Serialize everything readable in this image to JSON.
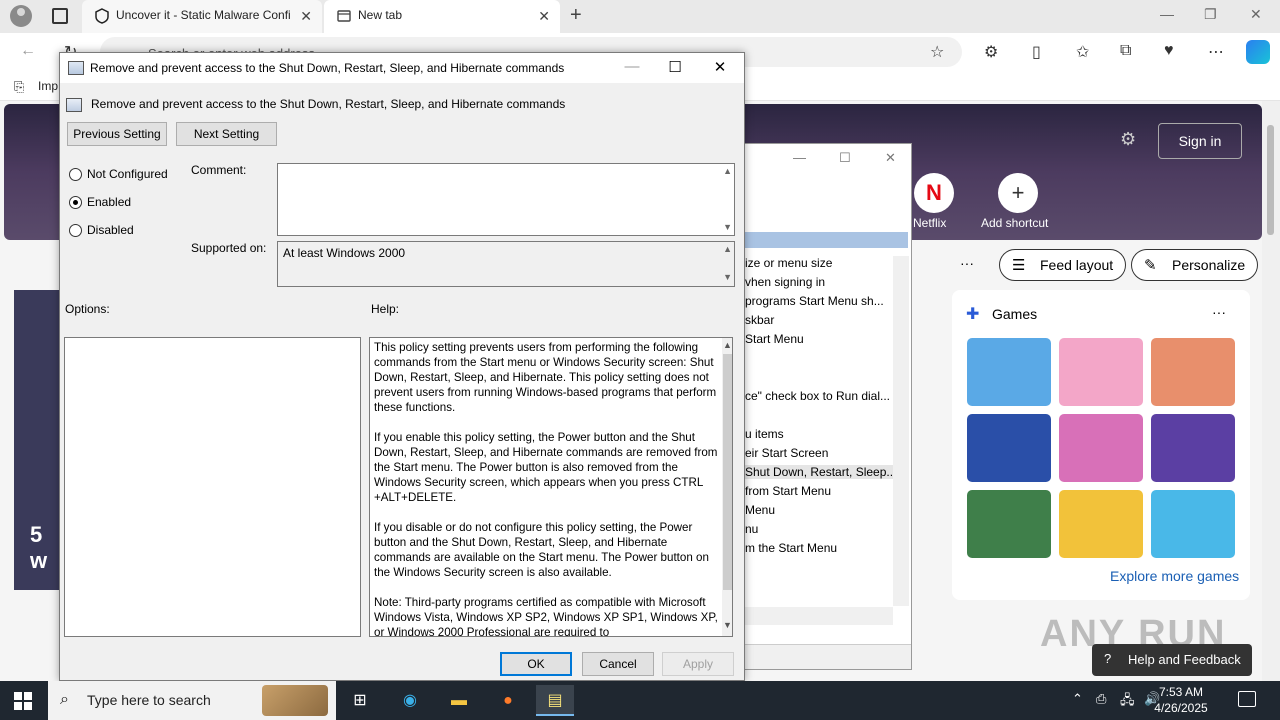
{
  "browser": {
    "tabs": [
      {
        "label": "Uncover it - Static Malware Confi",
        "active": false
      },
      {
        "label": "New tab",
        "active": true
      }
    ],
    "address_placeholder": "Search or enter web address",
    "favorites_label": "Imp"
  },
  "newtab": {
    "sign_in": "Sign in",
    "shortcuts": [
      {
        "label": "Netflix",
        "glyph": "N"
      },
      {
        "label": "Add shortcut",
        "glyph": "+"
      }
    ],
    "feed_layout": "Feed layout",
    "personalize": "Personalize",
    "games_title": "Games",
    "explore_games": "Explore more games",
    "help_feedback": "Help and Feedback",
    "watermark": "ANY RUN",
    "left_card_text": "5 w"
  },
  "background_window": {
    "items": [
      "ize or menu size",
      "vhen signing in",
      "programs Start Menu sh...",
      "skbar",
      "Start Menu",
      "",
      "",
      "ce\" check box to Run dial...",
      "",
      "u items",
      "eir Start Screen",
      "Shut Down, Restart, Sleep...",
      "from Start Menu",
      "Menu",
      "nu",
      "m the Start Menu"
    ],
    "selected_index": 11
  },
  "dialog": {
    "title": "Remove and prevent access to the Shut Down, Restart, Sleep, and Hibernate commands",
    "policy_name": "Remove and prevent access to the Shut Down, Restart, Sleep, and Hibernate commands",
    "previous_setting": "Previous Setting",
    "next_setting": "Next Setting",
    "options": {
      "not_configured": "Not Configured",
      "enabled": "Enabled",
      "disabled": "Disabled",
      "selected": "enabled"
    },
    "comment_label": "Comment:",
    "comment_value": "",
    "supported_label": "Supported on:",
    "supported_value": "At least Windows 2000",
    "options_label": "Options:",
    "help_label": "Help:",
    "help_paragraphs": [
      "This policy setting prevents users from performing the following commands from the Start menu or Windows Security screen: Shut Down, Restart, Sleep, and Hibernate. This policy setting does not prevent users from running Windows-based programs that perform these functions.",
      "If you enable this policy setting, the Power button and the Shut Down, Restart, Sleep, and Hibernate commands are removed from the Start menu. The Power button is also removed from the Windows Security screen, which appears when you press CTRL +ALT+DELETE.",
      "If you disable or do not configure this policy setting, the Power button and the Shut Down, Restart, Sleep, and Hibernate commands are available on the Start menu. The Power button on the Windows Security screen is also available.",
      "Note: Third-party programs certified as compatible with Microsoft Windows Vista, Windows XP SP2, Windows XP SP1, Windows XP, or Windows 2000 Professional are required to"
    ],
    "ok": "OK",
    "cancel": "Cancel",
    "apply": "Apply"
  },
  "taskbar": {
    "search_placeholder": "Type here to search",
    "time": "7:53 AM",
    "date": "4/26/2025"
  },
  "colors": {
    "taskbar": "#1f2730",
    "ok_border": "#0078d7",
    "selection_band": "#a9c3e3"
  }
}
